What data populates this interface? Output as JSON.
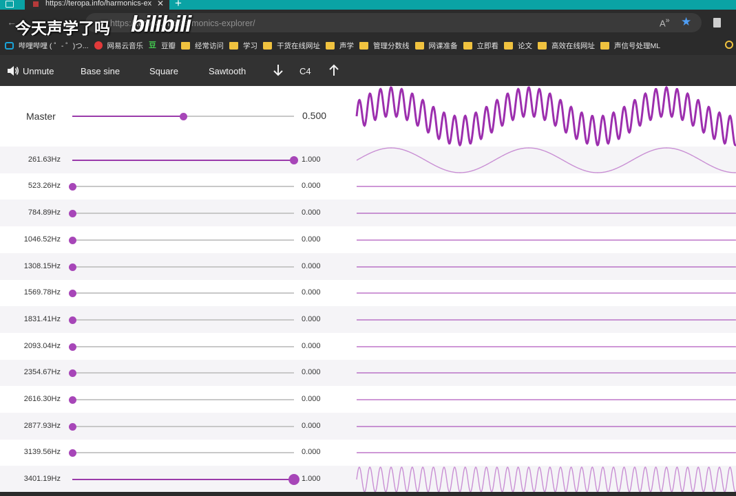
{
  "browser": {
    "tab_title": "https://teropa.info/harmonics-ex",
    "url_faded": "https://",
    "url_domain": "teropa.info",
    "url_path": "/harmonics-explorer/"
  },
  "watermark": {
    "text": "今天声学了吗",
    "logo": "bilibili"
  },
  "bookmarks": [
    {
      "label": "哔哩哔哩 ( ゜- ゜)つ...",
      "icon": "tv-icon"
    },
    {
      "label": "网易云音乐",
      "icon": "netease-icon"
    },
    {
      "label": "豆瓣",
      "icon": "douban-icon"
    },
    {
      "label": "经常访问",
      "icon": "folder-icon"
    },
    {
      "label": "学习",
      "icon": "folder-icon"
    },
    {
      "label": "干货在线网址",
      "icon": "folder-icon"
    },
    {
      "label": "声学",
      "icon": "folder-icon"
    },
    {
      "label": "管理分数线",
      "icon": "folder-icon"
    },
    {
      "label": "网课准备",
      "icon": "folder-icon"
    },
    {
      "label": "立即看",
      "icon": "folder-icon"
    },
    {
      "label": "论文",
      "icon": "folder-icon"
    },
    {
      "label": "高效在线网址",
      "icon": "folder-icon"
    },
    {
      "label": "声信号处理ML",
      "icon": "folder-icon"
    }
  ],
  "toolbar": {
    "unmute": "Unmute",
    "base_sine": "Base sine",
    "square": "Square",
    "sawtooth": "Sawtooth",
    "note": "C4"
  },
  "master": {
    "label": "Master",
    "value": "0.500",
    "level": 0.5
  },
  "harmonics": [
    {
      "freq": "261.63Hz",
      "value": "1.000",
      "level": 1.0,
      "multiple": 1
    },
    {
      "freq": "523.26Hz",
      "value": "0.000",
      "level": 0.0,
      "multiple": 2
    },
    {
      "freq": "784.89Hz",
      "value": "0.000",
      "level": 0.0,
      "multiple": 3
    },
    {
      "freq": "1046.52Hz",
      "value": "0.000",
      "level": 0.0,
      "multiple": 4
    },
    {
      "freq": "1308.15Hz",
      "value": "0.000",
      "level": 0.0,
      "multiple": 5
    },
    {
      "freq": "1569.78Hz",
      "value": "0.000",
      "level": 0.0,
      "multiple": 6
    },
    {
      "freq": "1831.41Hz",
      "value": "0.000",
      "level": 0.0,
      "multiple": 7
    },
    {
      "freq": "2093.04Hz",
      "value": "0.000",
      "level": 0.0,
      "multiple": 8
    },
    {
      "freq": "2354.67Hz",
      "value": "0.000",
      "level": 0.0,
      "multiple": 9
    },
    {
      "freq": "2616.30Hz",
      "value": "0.000",
      "level": 0.0,
      "multiple": 10
    },
    {
      "freq": "2877.93Hz",
      "value": "0.000",
      "level": 0.0,
      "multiple": 11
    },
    {
      "freq": "3139.56Hz",
      "value": "0.000",
      "level": 0.0,
      "multiple": 12
    },
    {
      "freq": "3401.19Hz",
      "value": "1.000",
      "level": 1.0,
      "multiple": 13
    }
  ],
  "colors": {
    "accent": "#a746b8",
    "wave": "#9c2fae",
    "wave_light": "#c98fd4",
    "toolbar_bg": "#323232",
    "browser_tab_strip": "#0aa3a5"
  }
}
